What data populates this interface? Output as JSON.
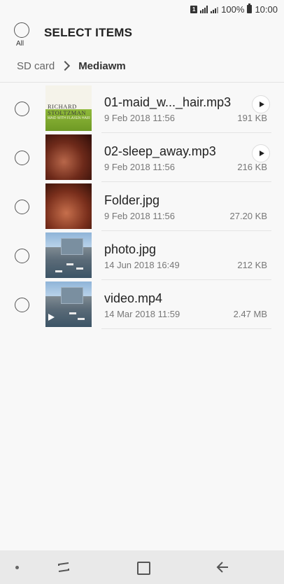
{
  "status_bar": {
    "sim_label": "1",
    "battery_percent": "100%",
    "time": "10:00"
  },
  "header": {
    "select_all_label": "All",
    "title": "SELECT ITEMS"
  },
  "breadcrumb": {
    "root": "SD card",
    "current": "Mediawm"
  },
  "thumbnails": {
    "cover_name": "RICHARD STOLTZMAN",
    "cover_subtitle": "MAID WITH FLAXEN HAIR"
  },
  "files": [
    {
      "name": "01-maid_w..._hair.mp3",
      "date": "9 Feb 2018 11:56",
      "size": "191 KB",
      "playable": true,
      "thumb": "album-cover"
    },
    {
      "name": "02-sleep_away.mp3",
      "date": "9 Feb 2018 11:56",
      "size": "216 KB",
      "playable": true,
      "thumb": "dark-photo"
    },
    {
      "name": "Folder.jpg",
      "date": "9 Feb 2018 11:56",
      "size": "27.20 KB",
      "playable": false,
      "thumb": "dark-photo"
    },
    {
      "name": "photo.jpg",
      "date": "14 Jun 2018 16:49",
      "size": "212 KB",
      "playable": false,
      "thumb": "harbor-photo"
    },
    {
      "name": "video.mp4",
      "date": "14 Mar 2018 11:59",
      "size": "2.47 MB",
      "playable": false,
      "thumb": "harbor-video"
    }
  ],
  "icons": {
    "play": "play-icon",
    "chevron": "chevron-right-icon",
    "nav_recents": "recents-icon",
    "nav_home": "home-icon",
    "nav_back": "back-icon"
  },
  "colors": {
    "background": "#f8f8f8",
    "nav_bar": "#e9e9e9",
    "divider": "#e4e4e4"
  }
}
